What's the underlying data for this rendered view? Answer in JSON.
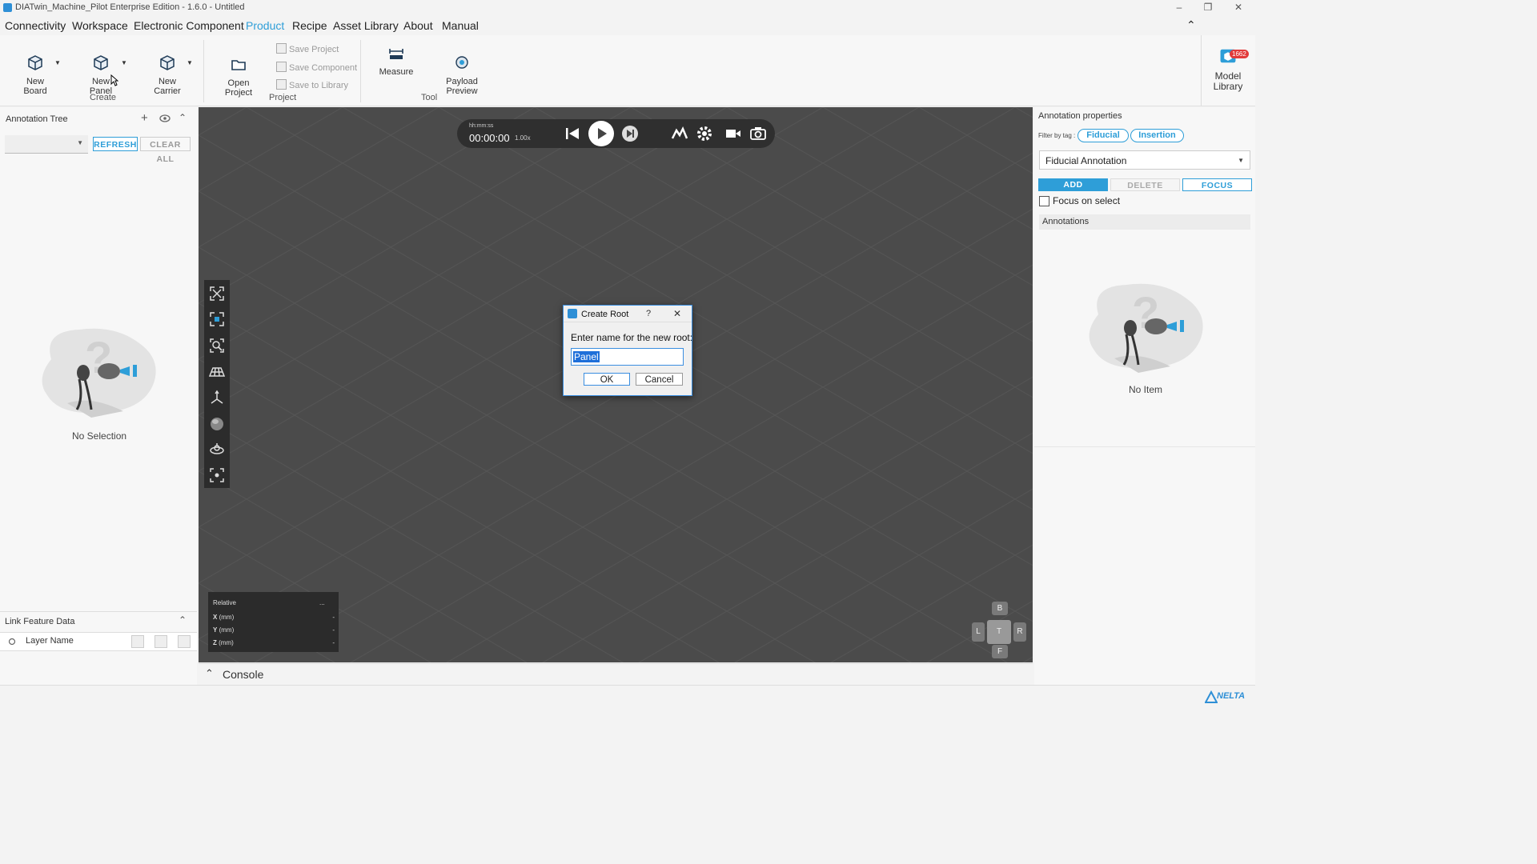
{
  "window": {
    "title": "DIATwin_Machine_Pilot Enterprise Edition - 1.6.0 - Untitled",
    "controls": {
      "minimize": "–",
      "restore": "❐",
      "close": "✕"
    }
  },
  "menu": {
    "items": [
      "Connectivity",
      "Workspace",
      "Electronic Component",
      "Product",
      "Recipe",
      "Asset Library",
      "About",
      "Manual"
    ],
    "active": "Product",
    "collapse_icon": "⌃"
  },
  "ribbon": {
    "create": {
      "new_board": "New\nBoard",
      "new_panel": "New\nPanel",
      "new_carrier": "New\nCarrier",
      "label": "Create"
    },
    "project": {
      "open_project": "Open\nProject",
      "save_project": "Save Project",
      "save_component": "Save Component",
      "save_to_library": "Save to Library",
      "label": "Project"
    },
    "tool": {
      "measure": "Measure",
      "payload_preview": "Payload\nPreview",
      "label": "Tool"
    },
    "model_library": {
      "label": "Model\nLibrary",
      "badge": "1662"
    }
  },
  "left_panel": {
    "annotation_tree_title": "Annotation Tree",
    "refresh": "REFRESH",
    "clear_all": "CLEAR ALL",
    "empty_text": "No Selection",
    "link_feature_title": "Link Feature Data",
    "layer_name_header": "Layer Name"
  },
  "viewport": {
    "time_format": "hh:mm:ss",
    "time": "00:00:00",
    "speed": "1.00x",
    "coord_panel": {
      "title": "Relative",
      "menu": "...",
      "rows": [
        {
          "axis": "X",
          "unit": "(mm)",
          "value": "-"
        },
        {
          "axis": "Y",
          "unit": "(mm)",
          "value": "-"
        },
        {
          "axis": "Z",
          "unit": "(mm)",
          "value": "-"
        }
      ]
    },
    "nav": {
      "top": "B",
      "left": "L",
      "center": "T",
      "right": "R",
      "bottom": "F"
    }
  },
  "dialog": {
    "title": "Create Root",
    "help": "?",
    "close": "✕",
    "prompt": "Enter name for the new root:",
    "input_value": "Panel",
    "ok": "OK",
    "cancel": "Cancel"
  },
  "console": {
    "label": "Console"
  },
  "right_panel": {
    "title": "Annotation properties",
    "filter_label": "Filter by tag :",
    "tags": [
      "Fiducial",
      "Insertion"
    ],
    "select_value": "Fiducial Annotation",
    "add": "ADD",
    "delete": "DELETE",
    "focus": "FOCUS",
    "focus_on_select": "Focus on select",
    "annotations_header": "Annotations",
    "empty_text": "No Item"
  },
  "status": {
    "brand": "NELTA"
  },
  "colors": {
    "accent": "#2e9ed8",
    "viewport_bg": "#4b4b4b",
    "badge": "#e23b3b"
  }
}
